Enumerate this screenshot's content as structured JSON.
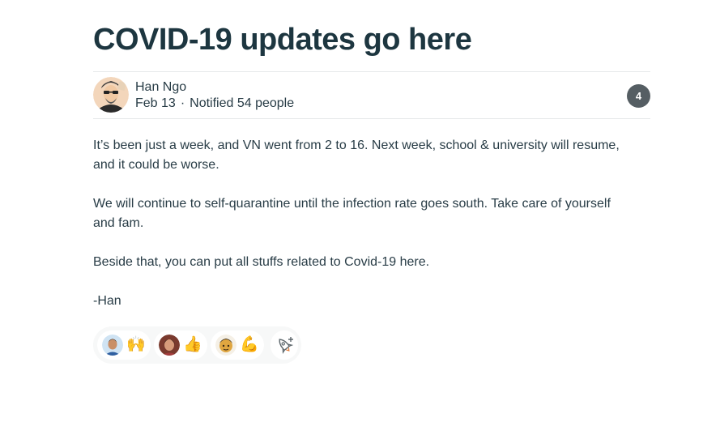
{
  "post": {
    "title": "COVID-19 updates go here",
    "author": "Han Ngo",
    "date": "Feb 13",
    "separator": "·",
    "notified": "Notified 54 people",
    "count_badge": "4",
    "paragraphs": [
      "It’s been just a week, and VN went from 2 to 16. Next week, school & university will resume, and it could be worse.",
      "We will continue to self-quarantine until the infection rate goes south. Take care of yourself and fam.",
      "Beside that, you can put all stuffs related to Covid-19 here.",
      "-Han"
    ]
  },
  "reactions": [
    {
      "emoji": "🙌",
      "avatar_icon": "user-avatar-1"
    },
    {
      "emoji": "👍",
      "avatar_icon": "user-avatar-2"
    },
    {
      "emoji": "💪",
      "avatar_icon": "user-avatar-3"
    }
  ],
  "add_reaction_icon": "add-reaction-icon",
  "colors": {
    "text": "#283c46",
    "title": "#1d3640",
    "badge": "#555e63",
    "divider": "#e6e9ea",
    "reaction_bar": "#f7f8f8"
  }
}
